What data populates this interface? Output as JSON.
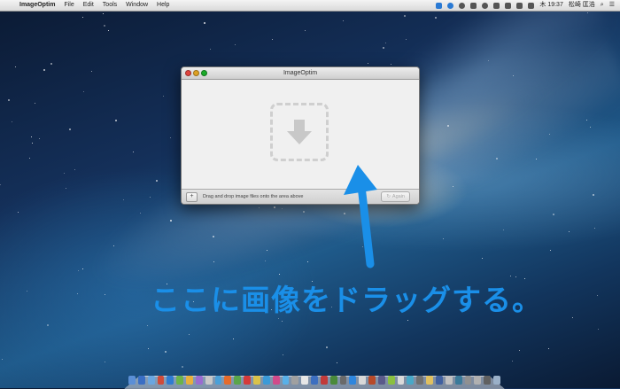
{
  "menubar": {
    "apple_glyph": "",
    "items": [
      "ImageOptim",
      "File",
      "Edit",
      "Tools",
      "Window",
      "Help"
    ],
    "clock": "木 19:37",
    "user": "松崎 匡浩",
    "search_glyph": "⌕",
    "list_glyph": "☰"
  },
  "window": {
    "title": "ImageOptim",
    "add_label": "+",
    "status_text": "Drag and drop image files onto the area above",
    "again_label": "Again",
    "again_icon": "↻"
  },
  "annotation": {
    "caption": "ここに画像をドラッグする。",
    "color": "#1a8fe8"
  },
  "dock": {
    "icon_colors": [
      "#5b8fd6",
      "#3a6ec4",
      "#6aa6e0",
      "#d04b3a",
      "#2f7bd1",
      "#6bb34a",
      "#e8b03c",
      "#9a6bd1",
      "#c8c8c8",
      "#4aa0d8",
      "#e46b2c",
      "#5aa54a",
      "#d43a3a",
      "#d9c24a",
      "#3b9ad8",
      "#d24a8a",
      "#58b0e8",
      "#a0a0a0",
      "#e6e6e6",
      "#3d6fc0",
      "#c23a3a",
      "#4a8a3a",
      "#6a6a6a",
      "#2e86de",
      "#d8d8d8",
      "#b74a2a",
      "#5a5a8a",
      "#8ac040",
      "#dadada",
      "#48a8c8",
      "#707070",
      "#e0c060",
      "#4060a0",
      "#c0c0c0",
      "#3a7a9a",
      "#909090",
      "#b0b0b0",
      "#606060",
      "#9ab0c8"
    ]
  }
}
